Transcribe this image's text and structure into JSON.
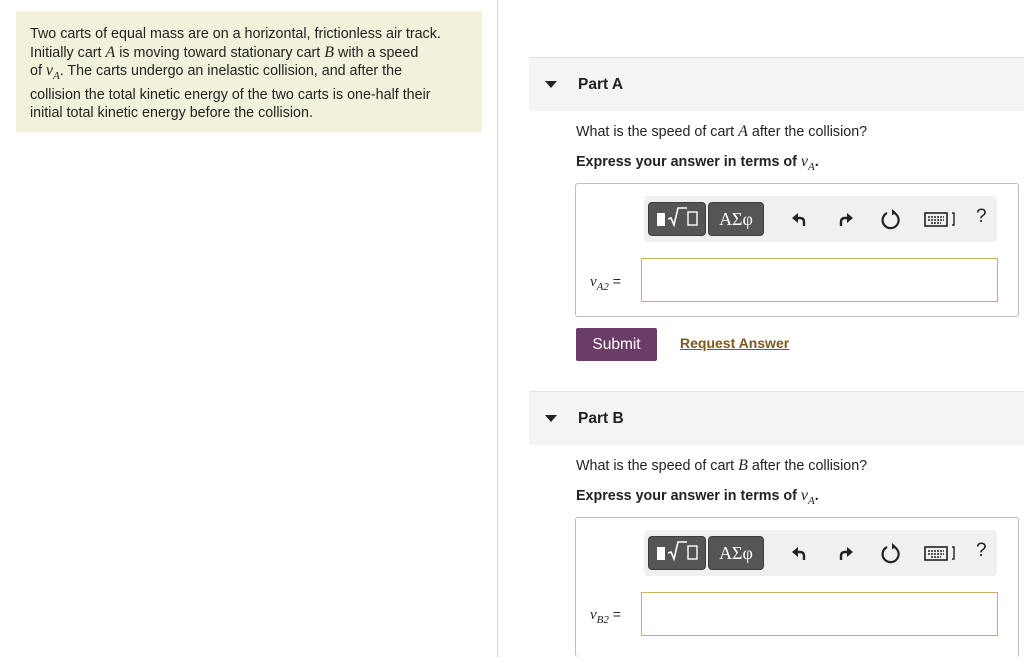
{
  "problem": {
    "line1": "Two carts of equal mass are on a horizontal, frictionless air track.",
    "line2_pre": "Initially cart ",
    "cartA": "A",
    "line2_mid": " is moving toward stationary cart ",
    "cartB": "B",
    "line2_post": " with a speed",
    "line3_pre": "of ",
    "vA_base": "v",
    "vA_sub": "A",
    "line3_post": ". The carts undergo an inelastic collision, and after the",
    "line4": "collision the total kinetic energy of the two carts is one-half their",
    "line5": "initial total kinetic energy before the collision."
  },
  "partA": {
    "title": "Part A",
    "question_pre": "What is the speed of cart ",
    "question_var": "A",
    "question_post": " after the collision?",
    "instruction_pre": "Express your answer in terms of ",
    "instruction_var": "v",
    "instruction_sub": "A",
    "instruction_post": ".",
    "eq_var": "v",
    "eq_sub": "A2",
    "eq_sign": " =",
    "input_value": ""
  },
  "actions": {
    "submit_label": "Submit",
    "request_label": "Request Answer"
  },
  "partB": {
    "title": "Part B",
    "question_pre": "What is the speed of cart ",
    "question_var": "B",
    "question_post": " after the collision?",
    "instruction_pre": "Express your answer in terms of ",
    "instruction_var": "v",
    "instruction_sub": "A",
    "instruction_post": ".",
    "eq_var": "v",
    "eq_sub": "B2",
    "eq_sign": " =",
    "input_value": ""
  },
  "toolbar": {
    "templates_icon": "templates-icon",
    "greek_label": "ΑΣφ",
    "undo_icon": "undo-icon",
    "redo_icon": "redo-icon",
    "reset_icon": "reset-icon",
    "keyboard_icon": "keyboard-icon",
    "help_label": "?"
  },
  "colors": {
    "problem_bg": "#f2f2dc",
    "submit_bg": "#6b3c67",
    "link": "#7a5a1e",
    "input_border": "#c9b066"
  }
}
